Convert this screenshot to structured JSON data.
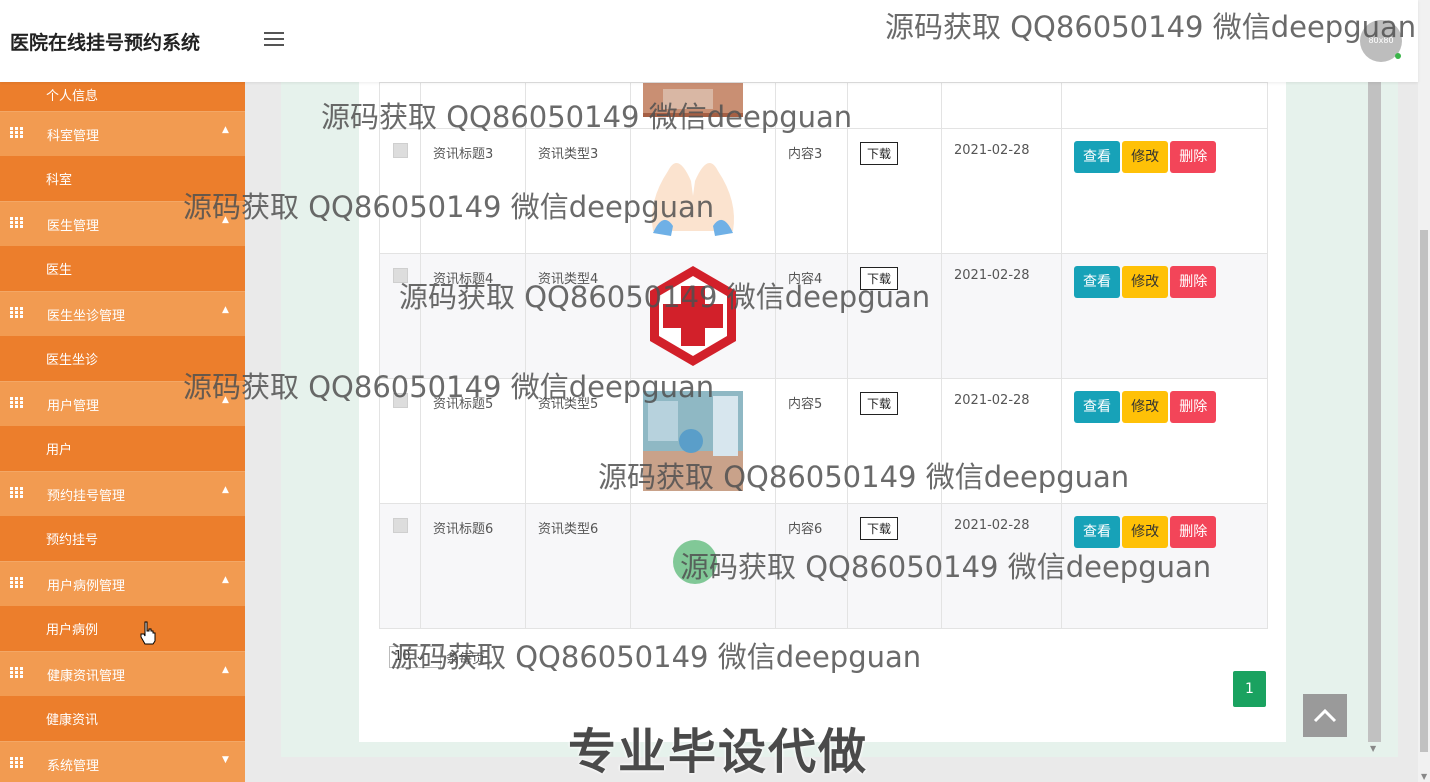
{
  "header": {
    "title": "医院在线挂号预约系统",
    "avatar_text": "80x80"
  },
  "sidebar": {
    "top_partial": "个人信息",
    "groups": [
      {
        "label": "科室管理",
        "caret": "▲",
        "sub": "科室"
      },
      {
        "label": "医生管理",
        "caret": "▲",
        "sub": "医生"
      },
      {
        "label": "医生坐诊管理",
        "caret": "▲",
        "sub": "医生坐诊"
      },
      {
        "label": "用户管理",
        "caret": "▲",
        "sub": "用户"
      },
      {
        "label": "预约挂号管理",
        "caret": "▲",
        "sub": "预约挂号"
      },
      {
        "label": "用户病例管理",
        "caret": "▲",
        "sub": "用户病例"
      },
      {
        "label": "健康资讯管理",
        "caret": "▲",
        "sub": "健康资讯"
      },
      {
        "label": "系统管理",
        "caret": "▼"
      }
    ]
  },
  "table": {
    "download_label": "下载",
    "view_label": "查看",
    "edit_label": "修改",
    "delete_label": "删除",
    "rows": [
      {
        "title": "资讯标题3",
        "type": "资讯类型3",
        "image": "hands-heart-image",
        "content": "内容3",
        "date": "2021-02-28"
      },
      {
        "title": "资讯标题4",
        "type": "资讯类型4",
        "image": "red-cross-image",
        "content": "内容4",
        "date": "2021-02-28"
      },
      {
        "title": "资讯标题5",
        "type": "资讯类型5",
        "image": "medical-data-image",
        "content": "内容5",
        "date": "2021-02-28"
      },
      {
        "title": "资讯标题6",
        "type": "资讯类型6",
        "image": "",
        "content": "内容6",
        "date": "2021-02-28"
      }
    ]
  },
  "pagination": {
    "page_size": "10",
    "page_size_label": "条每页",
    "current_page": "1"
  },
  "watermark": {
    "text": "源码获取 QQ86050149 微信deepguan",
    "banner": "专业毕设代做"
  },
  "colors": {
    "sidebar": "#f08d3c",
    "view": "#17a2b8",
    "edit": "#ffc107",
    "delete": "#f34559",
    "pager": "#1aa260"
  }
}
